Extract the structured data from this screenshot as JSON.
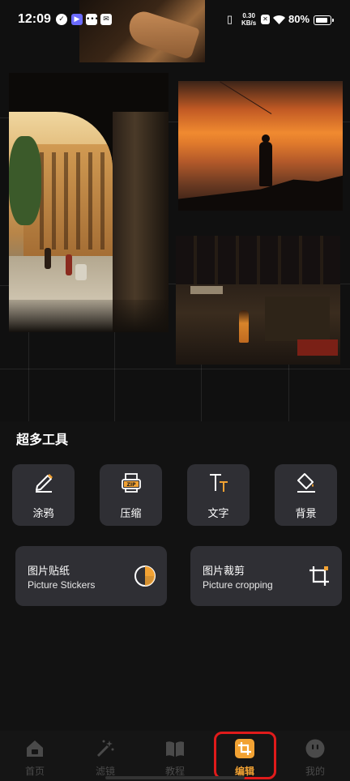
{
  "status_bar": {
    "time": "12:09",
    "net_speed_value": "0.30",
    "net_speed_unit": "KB/s",
    "battery": "80%"
  },
  "collage": {
    "photos": [
      "street-arch-photo",
      "sunset-fisherman-photo",
      "market-woman-photo",
      "piano-hand-photo"
    ]
  },
  "tools_section": {
    "title": "超多工具",
    "tools": [
      {
        "label": "涂鸦",
        "icon": "pencil-icon"
      },
      {
        "label": "压缩",
        "icon": "zip-icon"
      },
      {
        "label": "文字",
        "icon": "text-icon"
      },
      {
        "label": "背景",
        "icon": "paint-bucket-icon"
      }
    ],
    "feature_cards": [
      {
        "title_zh": "图片贴纸",
        "title_en": "Picture Stickers",
        "icon": "sticker-icon"
      },
      {
        "title_zh": "图片裁剪",
        "title_en": "Picture cropping",
        "icon": "crop-icon"
      }
    ]
  },
  "bottom_nav": {
    "items": [
      {
        "label": "首页",
        "icon": "home-icon"
      },
      {
        "label": "滤镜",
        "icon": "magic-wand-icon"
      },
      {
        "label": "教程",
        "icon": "book-icon"
      },
      {
        "label": "编辑",
        "icon": "edit-crop-icon"
      },
      {
        "label": "我的",
        "icon": "profile-face-icon"
      }
    ],
    "active": "编辑"
  },
  "colors": {
    "background": "#121212",
    "card": "#2f2f34",
    "accent": "#f2a233",
    "highlight_box": "#e01b1b",
    "nav_inactive": "#4a4a4a"
  }
}
